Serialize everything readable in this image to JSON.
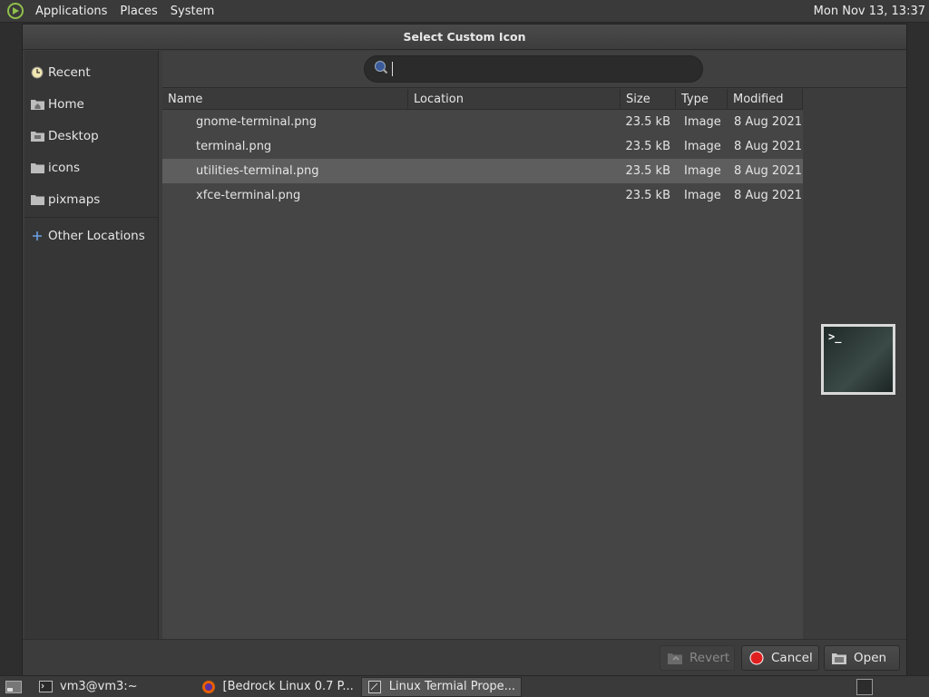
{
  "top_panel": {
    "menus": [
      "Applications",
      "Places",
      "System"
    ],
    "clock": "Mon Nov 13, 13:37"
  },
  "dialog": {
    "title": "Select Custom Icon",
    "search": {
      "value": "",
      "placeholder": ""
    },
    "sidebar": {
      "items": [
        {
          "label": "Recent",
          "icon": "recent-icon"
        },
        {
          "label": "Home",
          "icon": "home-folder-icon"
        },
        {
          "label": "Desktop",
          "icon": "desktop-folder-icon"
        },
        {
          "label": "icons",
          "icon": "folder-icon"
        },
        {
          "label": "pixmaps",
          "icon": "folder-icon"
        }
      ],
      "other_locations": "Other Locations"
    },
    "columns": [
      "Name",
      "Location",
      "Size",
      "Type",
      "Modified"
    ],
    "files": [
      {
        "name": "gnome-terminal.png",
        "location": "",
        "size": "23.5 kB",
        "type": "Image",
        "modified": "8 Aug 2021",
        "selected": false
      },
      {
        "name": "terminal.png",
        "location": "",
        "size": "23.5 kB",
        "type": "Image",
        "modified": "8 Aug 2021",
        "selected": false
      },
      {
        "name": "utilities-terminal.png",
        "location": "",
        "size": "23.5 kB",
        "type": "Image",
        "modified": "8 Aug 2021",
        "selected": true
      },
      {
        "name": "xfce-terminal.png",
        "location": "",
        "size": "23.5 kB",
        "type": "Image",
        "modified": "8 Aug 2021",
        "selected": false
      }
    ],
    "preview_prompt": ">_",
    "buttons": {
      "revert": "Revert",
      "cancel": "Cancel",
      "open": "Open"
    }
  },
  "taskbar": {
    "tasks": [
      {
        "label": "vm3@vm3:~",
        "icon": "terminal-icon"
      },
      {
        "label": "[Bedrock Linux 0.7 P...",
        "icon": "firefox-icon"
      },
      {
        "label": "Linux Termial Prope...",
        "icon": "window-icon"
      }
    ]
  },
  "colors": {
    "selected_row": "#5e5e5e",
    "panel_bg": "#3a3a3a",
    "dialog_bg": "#3c3c3c",
    "cancel_icon": "#e02020"
  }
}
